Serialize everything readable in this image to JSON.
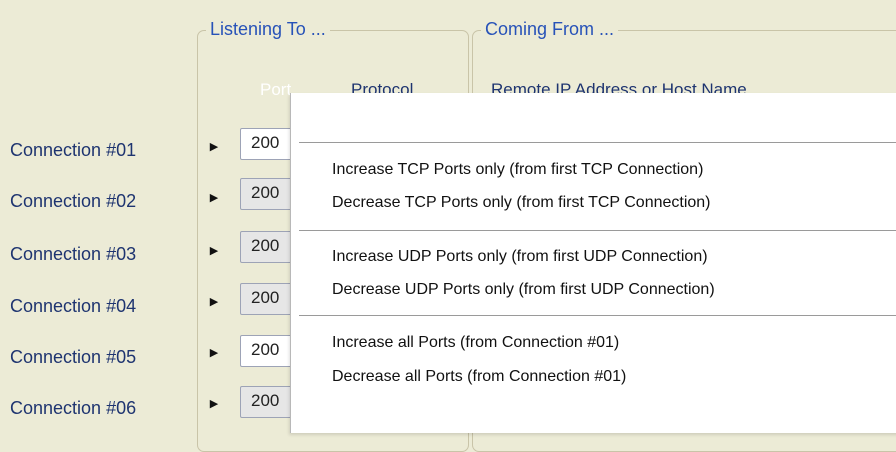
{
  "groups": {
    "listening_title": "Listening To ...",
    "coming_title": "Coming From ..."
  },
  "columns": {
    "port": "Port",
    "protocol": "Protocol",
    "remote": "Remote IP Address or Host Name"
  },
  "connections": [
    {
      "label": "Connection #01",
      "port": "200"
    },
    {
      "label": "Connection #02",
      "port": "200"
    },
    {
      "label": "Connection #03",
      "port": "200"
    },
    {
      "label": "Connection #04",
      "port": "200"
    },
    {
      "label": "Connection #05",
      "port": "200"
    },
    {
      "label": "Connection #06",
      "port": "200"
    }
  ],
  "menu": {
    "items": [
      "Increase TCP Ports only (from first TCP Connection)",
      "Decrease TCP Ports only (from first TCP Connection)",
      "Increase UDP Ports only (from first UDP Connection)",
      "Decrease UDP Ports only (from first UDP Connection)",
      "Increase all Ports (from Connection #01)",
      "Decrease all Ports (from Connection #01)"
    ]
  },
  "icons": {
    "expand": "triangle-right-icon"
  },
  "colors": {
    "background": "#ecebd6",
    "group_title": "#2752b8",
    "label": "#1e3470",
    "menu_bg": "#ffffff"
  }
}
